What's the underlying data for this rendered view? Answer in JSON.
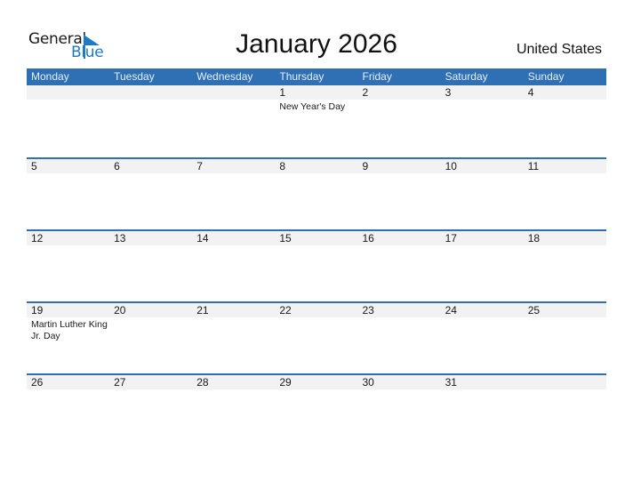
{
  "logo": {
    "line1": "General",
    "line2": "Blue"
  },
  "title": "January 2026",
  "country": "United States",
  "colors": {
    "header_bg": "#2e70b3",
    "date_strip": "#f2f2f2",
    "logo_blue": "#1f7ac4"
  },
  "weekdays": [
    "Monday",
    "Tuesday",
    "Wednesday",
    "Thursday",
    "Friday",
    "Saturday",
    "Sunday"
  ],
  "weeks": [
    {
      "days": [
        {
          "num": "",
          "holiday": ""
        },
        {
          "num": "",
          "holiday": ""
        },
        {
          "num": "",
          "holiday": ""
        },
        {
          "num": "1",
          "holiday": "New Year's Day"
        },
        {
          "num": "2",
          "holiday": ""
        },
        {
          "num": "3",
          "holiday": ""
        },
        {
          "num": "4",
          "holiday": ""
        }
      ]
    },
    {
      "days": [
        {
          "num": "5",
          "holiday": ""
        },
        {
          "num": "6",
          "holiday": ""
        },
        {
          "num": "7",
          "holiday": ""
        },
        {
          "num": "8",
          "holiday": ""
        },
        {
          "num": "9",
          "holiday": ""
        },
        {
          "num": "10",
          "holiday": ""
        },
        {
          "num": "11",
          "holiday": ""
        }
      ]
    },
    {
      "days": [
        {
          "num": "12",
          "holiday": ""
        },
        {
          "num": "13",
          "holiday": ""
        },
        {
          "num": "14",
          "holiday": ""
        },
        {
          "num": "15",
          "holiday": ""
        },
        {
          "num": "16",
          "holiday": ""
        },
        {
          "num": "17",
          "holiday": ""
        },
        {
          "num": "18",
          "holiday": ""
        }
      ]
    },
    {
      "days": [
        {
          "num": "19",
          "holiday": "Martin Luther King Jr. Day"
        },
        {
          "num": "20",
          "holiday": ""
        },
        {
          "num": "21",
          "holiday": ""
        },
        {
          "num": "22",
          "holiday": ""
        },
        {
          "num": "23",
          "holiday": ""
        },
        {
          "num": "24",
          "holiday": ""
        },
        {
          "num": "25",
          "holiday": ""
        }
      ]
    },
    {
      "days": [
        {
          "num": "26",
          "holiday": ""
        },
        {
          "num": "27",
          "holiday": ""
        },
        {
          "num": "28",
          "holiday": ""
        },
        {
          "num": "29",
          "holiday": ""
        },
        {
          "num": "30",
          "holiday": ""
        },
        {
          "num": "31",
          "holiday": ""
        },
        {
          "num": "",
          "holiday": ""
        }
      ]
    }
  ]
}
